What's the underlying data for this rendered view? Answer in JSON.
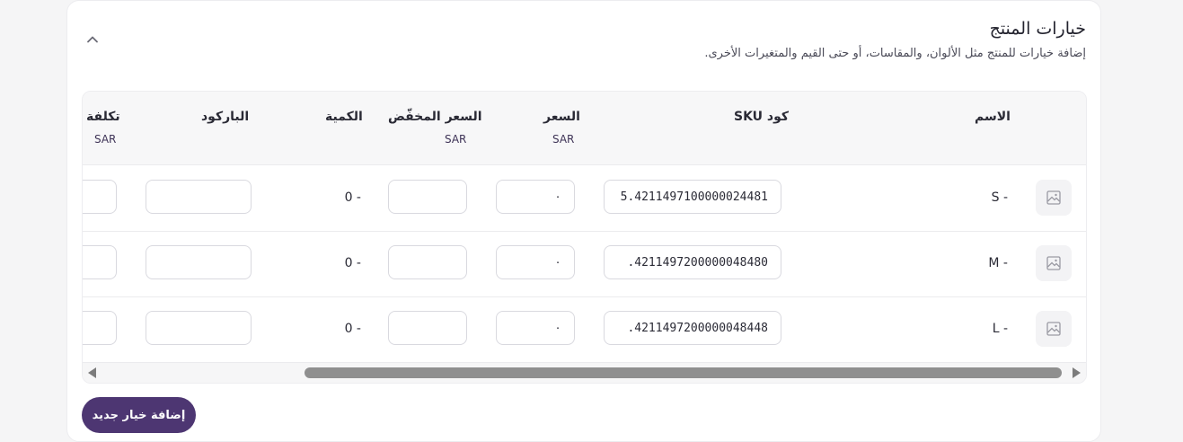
{
  "section": {
    "title": "خيارات المنتج",
    "subtitle": "إضافة خيارات للمنتج مثل الألوان، والمقاسات، أو حتى القيم والمتغيرات الأخرى."
  },
  "table": {
    "headers": {
      "name": "الاسم",
      "sku": "كود SKU",
      "price": "السعر",
      "price_currency": "SAR",
      "sale_price": "السعر المخفّض",
      "sale_currency": "SAR",
      "quantity": "الكمية",
      "barcode": "الباركود",
      "cost": "تكلفة",
      "cost_currency": "SAR"
    },
    "rows": [
      {
        "name": "S -",
        "sku": "5.4211497100000024481",
        "price": "٠",
        "sale_price": "",
        "quantity": "0 -",
        "barcode": "",
        "cost": ""
      },
      {
        "name": "M -",
        "sku": ".4211497200000048480",
        "price": "٠",
        "sale_price": "",
        "quantity": "0 -",
        "barcode": "",
        "cost": ""
      },
      {
        "name": "L -",
        "sku": ".4211497200000048448",
        "price": "٠",
        "sale_price": "",
        "quantity": "0 -",
        "barcode": "",
        "cost": ""
      }
    ]
  },
  "actions": {
    "add_option_label": "إضافة خيار جديد"
  },
  "icons": {
    "collapse": "chevron-up-icon",
    "row_image": "image-placeholder-icon"
  },
  "colors": {
    "accent": "#4d3672",
    "header_bg": "#f7f7f8"
  }
}
